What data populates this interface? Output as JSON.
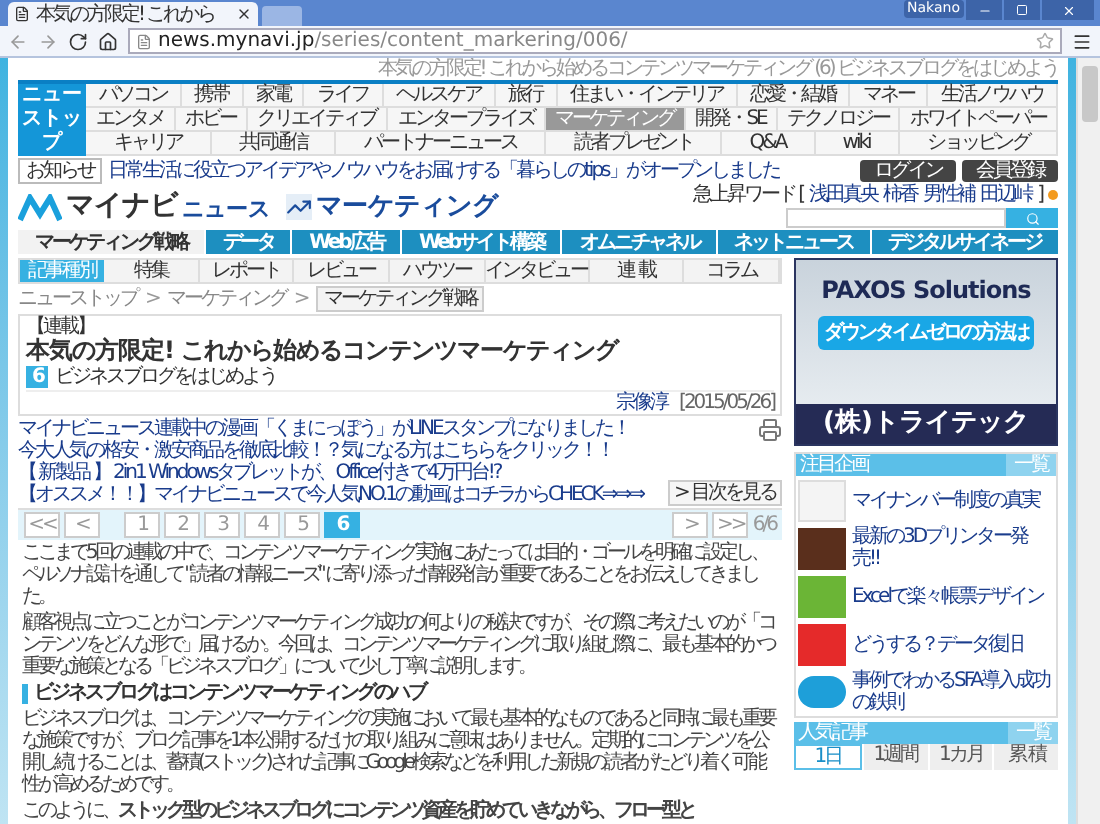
{
  "browser": {
    "tab_title": "本気の方限定! これから",
    "address": {
      "host": "news.mynavi.jp",
      "path": "/series/content_markering/006/"
    },
    "user": "Nakano"
  },
  "header": {
    "page_path": "本気の方限定! これから始めるコンテンツマーケティング (6) ビジネスブログをはじめよう",
    "home_button": "ニューストップ",
    "nav_rows": [
      [
        {
          "label": "パソコン",
          "selected": false
        },
        {
          "label": "携帯",
          "selected": false
        },
        {
          "label": "家電",
          "selected": false
        },
        {
          "label": "ライフ",
          "selected": false
        },
        {
          "label": "ヘルスケア",
          "selected": false
        },
        {
          "label": "旅行",
          "selected": false
        },
        {
          "label": "住まい・インテリア",
          "selected": false
        },
        {
          "label": "恋愛・結婚",
          "selected": false
        },
        {
          "label": "マネー",
          "selected": false
        },
        {
          "label": "生活ノウハウ",
          "selected": false
        }
      ],
      [
        {
          "label": "エンタメ",
          "selected": false
        },
        {
          "label": "ホビー",
          "selected": false
        },
        {
          "label": "クリエイティブ",
          "selected": false
        },
        {
          "label": "エンタープライズ",
          "selected": false
        },
        {
          "label": "マーケティング",
          "selected": true
        },
        {
          "label": "開発・SE",
          "selected": false
        },
        {
          "label": "テクノロジー",
          "selected": false
        },
        {
          "label": "ホワイトペーパー",
          "selected": false
        }
      ],
      [
        {
          "label": "キャリア",
          "selected": false
        },
        {
          "label": "共同通信",
          "selected": false
        },
        {
          "label": "パートナーニュース",
          "selected": false
        },
        {
          "label": "読者プレゼント",
          "selected": false
        },
        {
          "label": "Q&A",
          "selected": false
        },
        {
          "label": "wiki",
          "selected": false
        },
        {
          "label": "ショッピング",
          "selected": false
        }
      ]
    ],
    "notice": {
      "label": "お知らせ",
      "text": "日常生活に役立つアイデアやノウハウをお届けする「暮らしのtips」がオープンしました"
    },
    "buttons": [
      "ログイン",
      "会員登録"
    ],
    "logo": {
      "brand": "マイナビ",
      "suffix": "ニュース"
    },
    "channel": "マーケティング",
    "trending": {
      "label": "急上昇ワード [",
      "words": [
        "浅田真央",
        "柿香",
        "男性補",
        "田辺峠"
      ],
      "end": "]"
    },
    "category_tabs": [
      {
        "label": "マーケティング戦略",
        "selected": true
      },
      {
        "label": "データ",
        "selected": false
      },
      {
        "label": "Web広告",
        "selected": false
      },
      {
        "label": "Webサイト構築",
        "selected": false
      },
      {
        "label": "オムニチャネル",
        "selected": false
      },
      {
        "label": "ネットニュース",
        "selected": false
      },
      {
        "label": "デジタルサイネージ",
        "selected": false
      }
    ],
    "article_type": {
      "label": "記事種別",
      "tabs": [
        "特集",
        "レポート",
        "レビュー",
        "ハウツー",
        "インタビュー",
        "連 載",
        "コラム"
      ]
    }
  },
  "breadcrumb": [
    {
      "label": "ニューストップ",
      "current": false
    },
    {
      "label": "マーケティング",
      "current": false
    },
    {
      "label": "マーケティング戦略",
      "current": true
    }
  ],
  "breadcrumb_separator": ">",
  "article": {
    "series_label": "【連載】",
    "title": "本気の方限定! これから始めるコンテンツマーケティング",
    "part_number": "6",
    "part_title": "ビジネスブログをはじめよう",
    "author": "宗像淳",
    "date": "[2015/05/26]",
    "promo_links": [
      "マイナビニュース連載中の漫画「くまにっぽう」がLINEスタンプになりました！",
      "今大人気の格安・激安商品を徹底比較！？気になる方はこちらをクリック！！",
      "【 新製品 】 2in1 Windowsタブレットが、Office付きで4万円台!?",
      "【オススメ！！】マイナビニュースで今人気NO.1の動画はコチラからCHECK⇒⇒⇒"
    ],
    "toc_button": "> 目次を見る",
    "pagination": {
      "first": "<<",
      "prev": "<",
      "pages": [
        {
          "label": "1",
          "selected": false
        },
        {
          "label": "2",
          "selected": false
        },
        {
          "label": "3",
          "selected": false
        },
        {
          "label": "4",
          "selected": false
        },
        {
          "label": "5",
          "selected": false
        },
        {
          "label": "6",
          "selected": true
        }
      ],
      "next": ">",
      "last": ">>",
      "count": "6/6"
    },
    "body": [
      {
        "kind": "paragraph",
        "text": "ここまで5回の連載の中で、コンテンツマーケティング実施にあたっては目的・ゴールを明確に設定し、ペルソナ設計を通して \"読者の情報ニーズ\" に寄り添った情報発信が重要であることをお伝えしてきました。"
      },
      {
        "kind": "paragraph",
        "text": "顧客視点に立つことがコンテンツマーケティング成功の何よりの秘訣ですが、その際に考えたいのが「コンテンツをどんな形で」届けるか。今回は、コンテンツマーケティングに取り組む際に、最も基本的かつ重要な施策となる「ビジネスブログ」について少し丁寧に説明します。"
      },
      {
        "kind": "heading",
        "text": "ビジネスブログはコンテンツマーケティングのハブ"
      },
      {
        "kind": "paragraph",
        "text": "ビジネスブログは、コンテンツマーケティングの実施において最も基本的なものであると同時に最も重要な施策ですが、ブログ記事を1本公開するだけの取り組みに意味はありません。定期的にコンテンツを公開し続けることは、蓄積(ストック)された記事にGoogle検索などを利用した新規の読者がたどり着く可能性が高めるためです。"
      },
      {
        "kind": "paragraph",
        "text": "このように、**ストック型のビジネスブログにコンテンツ資産を貯めていきながら、フロー型と**"
      }
    ]
  },
  "sidebar": {
    "ad": {
      "headline": "PAXOS Solutions",
      "cta": "ダウンタイムゼロの方法は",
      "company": "(株)トライテック"
    },
    "featured": {
      "title": "注目企画",
      "more": "一覧",
      "items": [
        {
          "kind": "rabbit",
          "text": "マイナンバー制度の真実"
        },
        {
          "kind": "printer",
          "text": "最新の3Dプリンター発売!!"
        },
        {
          "kind": "excel",
          "text": "Excelで楽々帳票デザイン"
        },
        {
          "kind": "recovery",
          "text": "どうする？データ復旧"
        },
        {
          "kind": "cloud",
          "text": "事例でわかるSFA導入成功の鉄則"
        }
      ]
    },
    "ranking": {
      "title": "人気記事",
      "more": "一覧",
      "tabs": [
        {
          "label": "1日",
          "selected": true
        },
        {
          "label": "1週間",
          "selected": false
        },
        {
          "label": "1カ月",
          "selected": false
        },
        {
          "label": "累 積",
          "selected": false
        }
      ]
    }
  }
}
